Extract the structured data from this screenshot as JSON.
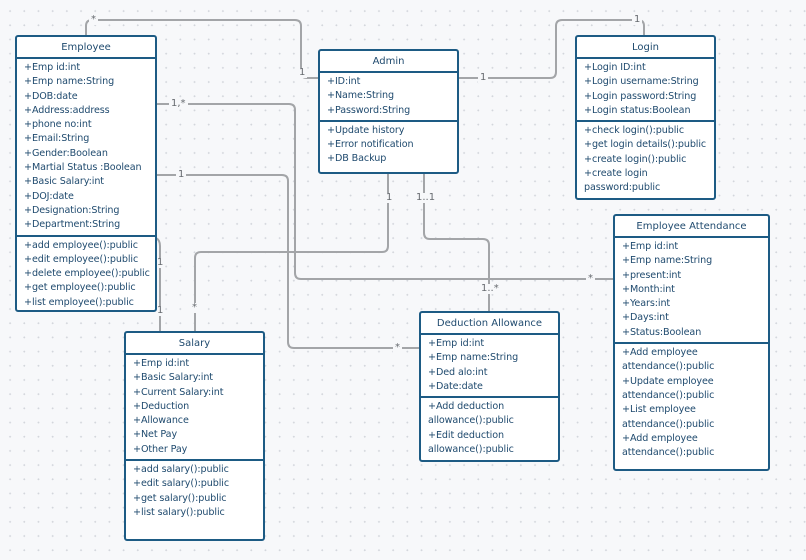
{
  "classes": {
    "employee": {
      "name": "Employee",
      "attributes": [
        "+Emp id:int",
        "+Emp name:String",
        "+DOB:date",
        "+Address:address",
        "+phone no:int",
        "+Email:String",
        "+Gender:Boolean",
        "+Martial Status :Boolean",
        "+Basic Salary:int",
        "+DOJ:date",
        "+Designation:String",
        "+Department:String"
      ],
      "methods": [
        "+add employee():public",
        "+edit employee():public",
        "+delete employee():public",
        "+get employee():public",
        "+list employee():public"
      ]
    },
    "admin": {
      "name": "Admin",
      "attributes": [
        "+ID:int",
        "+Name:String",
        "+Password:String"
      ],
      "methods": [
        "+Update history",
        "+Error notification",
        "+DB Backup"
      ]
    },
    "login": {
      "name": "Login",
      "attributes": [
        "+Login ID:int",
        "+Login username:String",
        "+Login password:String",
        "+Login status:Boolean"
      ],
      "methods": [
        "+check login():public",
        "+get login details():public",
        "+create login():public",
        "+create login",
        "password:public"
      ]
    },
    "attendance": {
      "name": "Employee Attendance",
      "attributes": [
        "+Emp id:int",
        "+Emp name:String",
        "+present:int",
        "+Month:int",
        "+Years:int",
        "+Days:int",
        "+Status:Boolean"
      ],
      "methods": [
        "+Add employee",
        "attendance():public",
        "+Update employee",
        "attendance():public",
        "+List employee",
        "attendance():public",
        "+Add employee",
        "attendance():public"
      ]
    },
    "salary": {
      "name": "Salary",
      "attributes": [
        "+Emp id:int",
        "+Basic Salary:int",
        "+Current Salary:int",
        "+Deduction",
        "+Allowance",
        "+Net Pay",
        "+Other Pay"
      ],
      "methods": [
        "+add salary():public",
        "+edit salary():public",
        "+get salary():public",
        "+list salary():public"
      ]
    },
    "deduction": {
      "name": "Deduction Allowance",
      "attributes": [
        "+Emp id:int",
        "+Emp name:String",
        "+Ded alo:int",
        "+Date:date"
      ],
      "methods": [
        "+Add deduction",
        "allowance():public",
        "+Edit deduction",
        "allowance():public"
      ]
    }
  },
  "multiplicities": {
    "employee_admin_emp": "*",
    "employee_admin_admin": "1",
    "admin_login_admin": "1",
    "admin_login_login": "1",
    "employee_attendance_emp": "1,*",
    "employee_attendance_att": "*",
    "employee_deduction_emp": "1",
    "employee_deduction_ded": "*",
    "employee_salary_top": "1",
    "employee_salary_bottom": "1",
    "admin_salary_admin": "1",
    "admin_salary_salary": "*",
    "admin_deduction_admin": "1..1",
    "admin_deduction_ded": "1..*"
  }
}
